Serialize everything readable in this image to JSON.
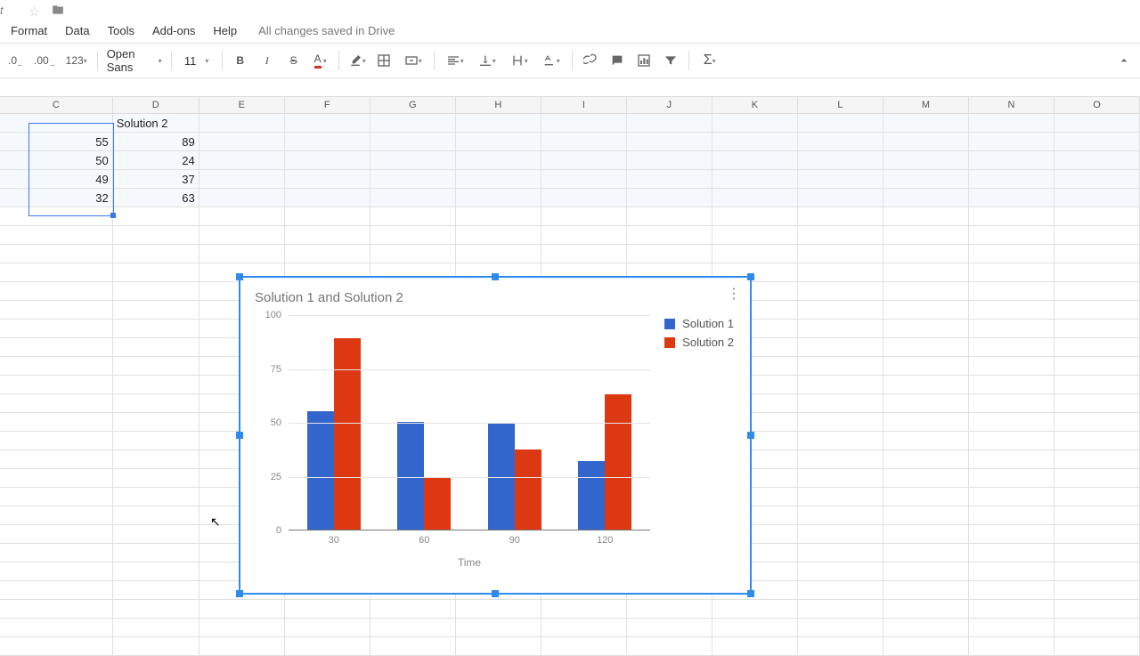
{
  "titlebar": {
    "fragment": "t"
  },
  "menu": {
    "items": [
      "Format",
      "Data",
      "Tools",
      "Add-ons",
      "Help"
    ],
    "save_status": "All changes saved in Drive"
  },
  "toolbar": {
    "decrease_decimal": ".0",
    "increase_decimal": ".00",
    "number_format": "123",
    "font_name": "Open Sans",
    "font_size": "11"
  },
  "columns": [
    "C",
    "D",
    "E",
    "F",
    "G",
    "H",
    "I",
    "J",
    "K",
    "L",
    "M",
    "N",
    "O"
  ],
  "cells": {
    "header_d": "Solution 2",
    "c_1": "55",
    "d_1": "89",
    "c_2": "50",
    "d_2": "24",
    "c_3": "49",
    "d_3": "37",
    "c_4": "32",
    "d_4": "63"
  },
  "chart_data": {
    "type": "bar",
    "title": "Solution 1 and Solution 2",
    "xlabel": "Time",
    "ylabel": "",
    "categories": [
      "30",
      "60",
      "90",
      "120"
    ],
    "series": [
      {
        "name": "Solution 1",
        "color": "#3366cc",
        "values": [
          55,
          50,
          49,
          32
        ]
      },
      {
        "name": "Solution 2",
        "color": "#dc3912",
        "values": [
          89,
          24,
          37,
          63
        ]
      }
    ],
    "ylim": [
      0,
      100
    ],
    "yticks": [
      0,
      25,
      50,
      75,
      100
    ]
  }
}
